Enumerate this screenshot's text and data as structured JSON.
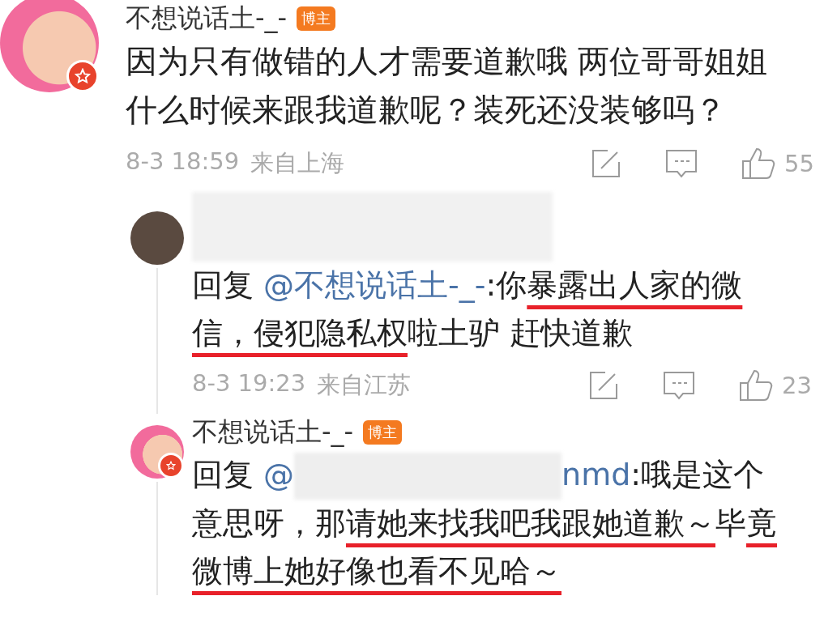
{
  "comments": [
    {
      "author": {
        "kind": "named",
        "name": "不想说话土-_-",
        "badge": "博主"
      },
      "avatar": {
        "kind": "cartoon",
        "verified": true
      },
      "body": [
        {
          "kind": "plain",
          "text": "因为只有做错的人才需要道歉哦 两位哥哥姐姐什么时候来跟我道歉呢？装死还没装够吗？"
        }
      ],
      "time": "8-3 18:59",
      "location": "来自上海",
      "likes": "55",
      "replies": [
        {
          "author": {
            "kind": "hidden"
          },
          "avatar": {
            "kind": "photo"
          },
          "body": [
            {
              "kind": "plain",
              "text": "回复 "
            },
            {
              "kind": "mention",
              "text": "@不想说话土-_-"
            },
            {
              "kind": "plain",
              "text": ":你"
            },
            {
              "kind": "marked",
              "text": "暴露出人家的微信，侵犯隐私权"
            },
            {
              "kind": "plain",
              "text": "啦土驴 赶快道歉"
            }
          ],
          "time": "8-3 19:23",
          "location": "来自江苏",
          "likes": "23"
        },
        {
          "author": {
            "kind": "named",
            "name": "不想说话土-_-",
            "badge": "博主"
          },
          "avatar": {
            "kind": "cartoon",
            "verified": true
          },
          "body": [
            {
              "kind": "plain",
              "text": "回复 "
            },
            {
              "kind": "mention",
              "text": "@"
            },
            {
              "kind": "hidden"
            },
            {
              "kind": "mention",
              "text": "nmd"
            },
            {
              "kind": "plain",
              "text": ":哦是这个意思呀，那"
            },
            {
              "kind": "marked",
              "text": "请她来找我吧我跟她道歉～"
            },
            {
              "kind": "plain",
              "text": "毕"
            },
            {
              "kind": "marked",
              "text": "竟微博上她好像也看不见哈～"
            }
          ]
        }
      ]
    }
  ]
}
